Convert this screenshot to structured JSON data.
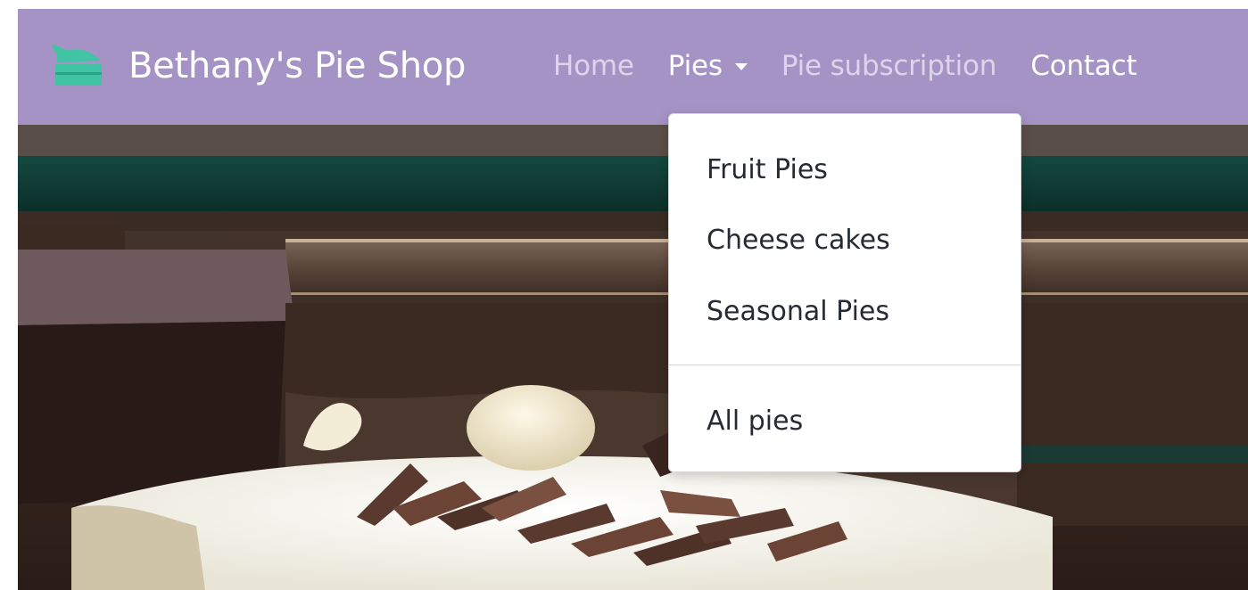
{
  "brand": {
    "name": "Bethany's Pie Shop",
    "logo_icon": "pie-slice-icon",
    "logo_color": "#3fc5a3"
  },
  "navbar": {
    "background": "#a593c5",
    "items": [
      {
        "label": "Home"
      },
      {
        "label": "Pies",
        "has_dropdown": true,
        "caret_icon": "caret-down-icon"
      },
      {
        "label": "Pie subscription"
      },
      {
        "label": "Contact"
      }
    ]
  },
  "dropdown": {
    "items": [
      {
        "label": "Fruit Pies"
      },
      {
        "label": "Cheese cakes"
      },
      {
        "label": "Seasonal Pies"
      }
    ],
    "footer_item": {
      "label": "All pies"
    }
  }
}
